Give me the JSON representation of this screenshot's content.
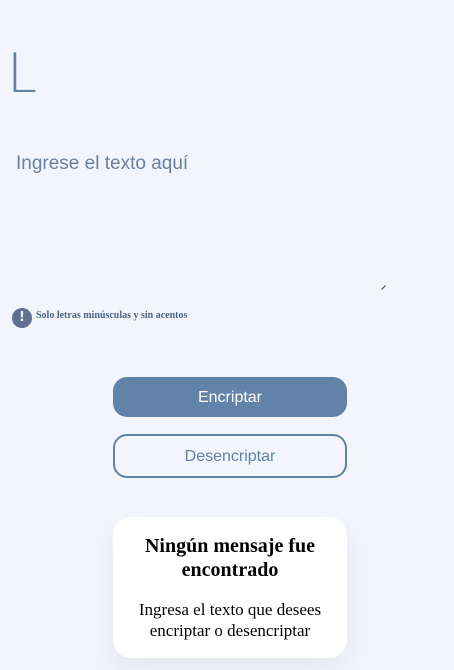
{
  "app": {
    "logo_text": "L"
  },
  "editor": {
    "placeholder": "Ingrese el texto aquí"
  },
  "hint": {
    "icon": "exclamation-circle-icon",
    "icon_glyph": "!",
    "text": "Solo letras minúsculas y sin acentos"
  },
  "actions": {
    "encrypt_label": "Encriptar",
    "decrypt_label": "Desencriptar"
  },
  "result": {
    "title": "Ningún mensaje fue encontrado",
    "message": "Ingresa el texto que desees encriptar o desencriptar"
  },
  "colors": {
    "accent": "#6382a8",
    "background": "#f3f5fc",
    "card": "#ffffff"
  }
}
